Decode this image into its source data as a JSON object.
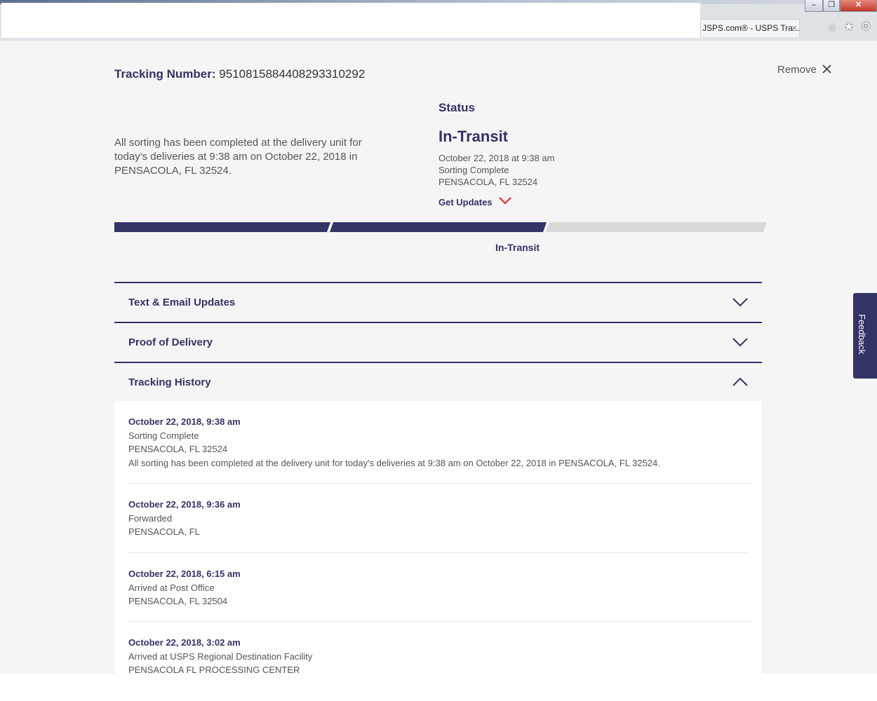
{
  "browser": {
    "tab_title": "JSPS.com® - USPS Tra...",
    "tab_close": "×"
  },
  "tracking": {
    "label": "Tracking Number:",
    "number": "9510815884408293310292",
    "remove_label": "Remove"
  },
  "summary_text": "All sorting has been completed at the delivery unit for today's deliveries at 9:38 am on October 22, 2018 in PENSACOLA, FL 32524.",
  "status": {
    "label": "Status",
    "value": "In-Transit",
    "datetime": "October 22, 2018 at 9:38 am",
    "event": "Sorting Complete",
    "location": "PENSACOLA, FL 32524",
    "get_updates": "Get Updates"
  },
  "progress": {
    "segments_complete": 2,
    "segments_total": 3,
    "label": "In-Transit"
  },
  "accordions": {
    "text_email": "Text & Email Updates",
    "proof": "Proof of Delivery",
    "history": "Tracking History"
  },
  "history_events": [
    {
      "date": "October 22, 2018, 9:38 am",
      "event": "Sorting Complete",
      "location": "PENSACOLA, FL 32524",
      "detail": "All sorting has been completed at the delivery unit for today's deliveries at 9:38 am on October 22, 2018 in PENSACOLA, FL 32524."
    },
    {
      "date": "October 22, 2018, 9:36 am",
      "event": "Forwarded",
      "location": "PENSACOLA, FL"
    },
    {
      "date": "October 22, 2018, 6:15 am",
      "event": "Arrived at Post Office",
      "location": "PENSACOLA, FL 32504"
    },
    {
      "date": "October 22, 2018, 3:02 am",
      "event": "Arrived at USPS Regional Destination Facility",
      "location": "PENSACOLA FL PROCESSING CENTER"
    }
  ],
  "feedback_label": "Feedback",
  "colors": {
    "navy": "#333366",
    "accent_red": "#e02020",
    "progress_empty": "#d9d9d9",
    "page_bg": "#f5f5f5"
  }
}
